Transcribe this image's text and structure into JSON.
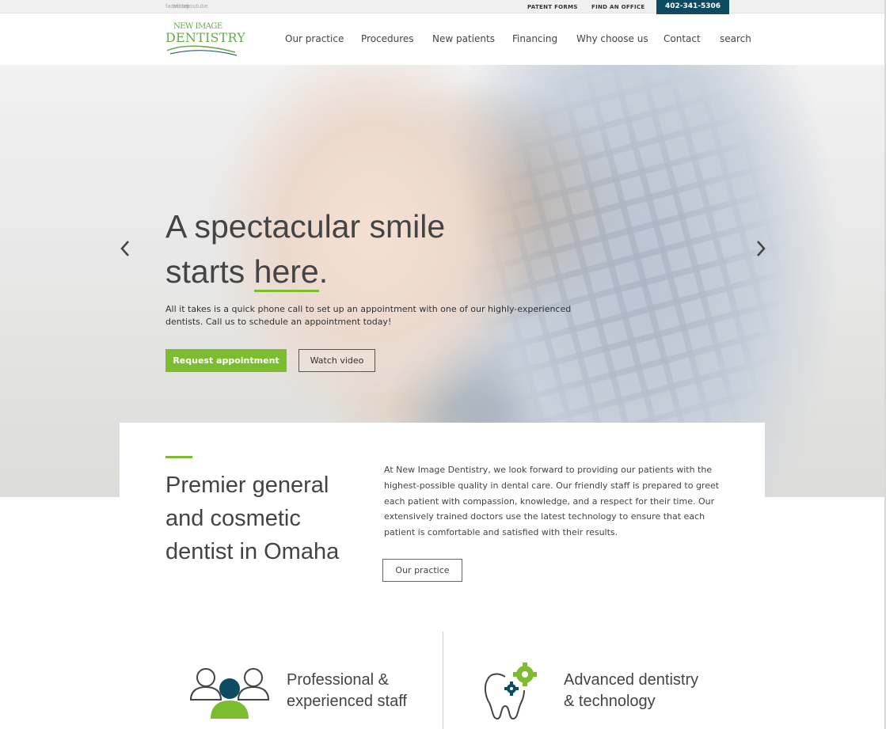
{
  "topbar": {
    "social_links": [
      "facebook",
      "twitter",
      "youtube"
    ],
    "patient_forms": "PATENT FORMS",
    "find_office": "FIND AN OFFICE",
    "phone": "402-341-5306"
  },
  "header": {
    "logo_line1": "NEW IMAGE",
    "logo_line2": "DENTISTRY",
    "nav": [
      "Our practice",
      "Procedures",
      "New patients",
      "Financing",
      "Why choose us",
      "Contact",
      "search"
    ]
  },
  "hero": {
    "title_line1": "A spectacular smile",
    "title_line2_pre": "starts ",
    "title_line2_em": "here",
    "title_line2_post": ".",
    "text": "All it takes is a quick phone call to set up an appointment with one of our highly-experienced dentists. Call us to schedule an appointment today!",
    "primary_button": "Request appointment",
    "secondary_button": "Watch video"
  },
  "intro": {
    "title": "Premier general and cosmetic dentist in Omaha",
    "text": "At New Image Dentistry, we look forward to providing our patients with the highest-possible quality in dental care. Our friendly staff is prepared to greet each patient with compassion, knowledge, and a respect for their time. Our extensively trained doctors use the latest technology to ensure that each patient is comfortable and satisfied with their results.",
    "button": "Our practice"
  },
  "features": [
    {
      "line1": "Professional &",
      "line2": "experienced staff",
      "icon": "people-icon"
    },
    {
      "line1": "Advanced dentistry",
      "line2": "& technology",
      "icon": "tooth-gear-icon"
    }
  ],
  "colors": {
    "accent": "#7dbb2f",
    "brand_dark": "#0d4b63",
    "text": "#444444"
  }
}
